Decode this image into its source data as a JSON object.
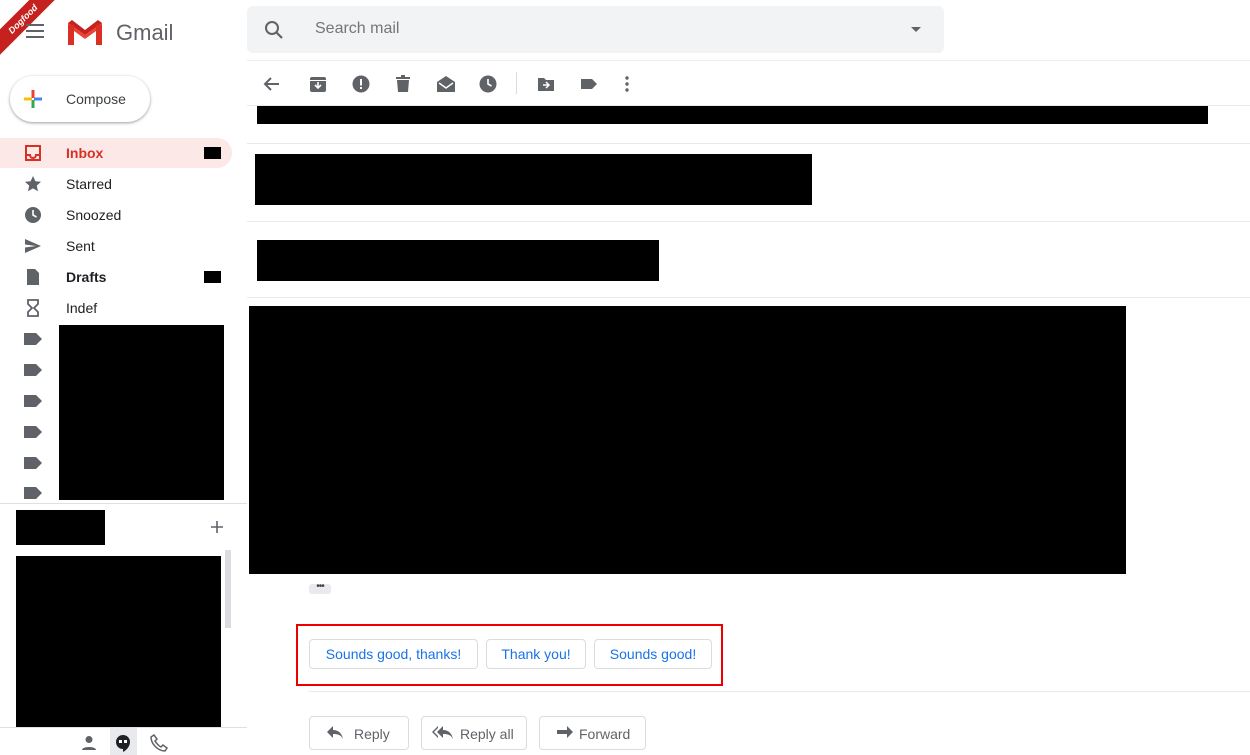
{
  "badge": "Dogfood",
  "app": {
    "name": "Gmail"
  },
  "search": {
    "placeholder": "Search mail"
  },
  "compose": {
    "label": "Compose"
  },
  "nav": [
    {
      "label": "Inbox",
      "icon": "inbox-icon"
    },
    {
      "label": "Starred",
      "icon": "star-icon"
    },
    {
      "label": "Snoozed",
      "icon": "clock-icon"
    },
    {
      "label": "Sent",
      "icon": "send-icon"
    },
    {
      "label": "Drafts",
      "icon": "draft-icon"
    },
    {
      "label": "Indef",
      "icon": "hourglass-icon"
    }
  ],
  "hangouts": {
    "add_icon": "plus-icon"
  },
  "toolbar": [
    "back-icon",
    "archive-icon",
    "report-spam-icon",
    "delete-icon",
    "mark-unread-icon",
    "snooze-icon",
    "move-to-icon",
    "label-icon",
    "more-icon"
  ],
  "smart_replies": [
    "Sounds good, thanks!",
    "Thank you!",
    "Sounds good!"
  ],
  "actions": {
    "reply": "Reply",
    "reply_all": "Reply all",
    "forward": "Forward"
  },
  "colors": {
    "accent_red": "#d93025",
    "link_blue": "#1a73e8",
    "highlight_border": "#ee0000"
  }
}
